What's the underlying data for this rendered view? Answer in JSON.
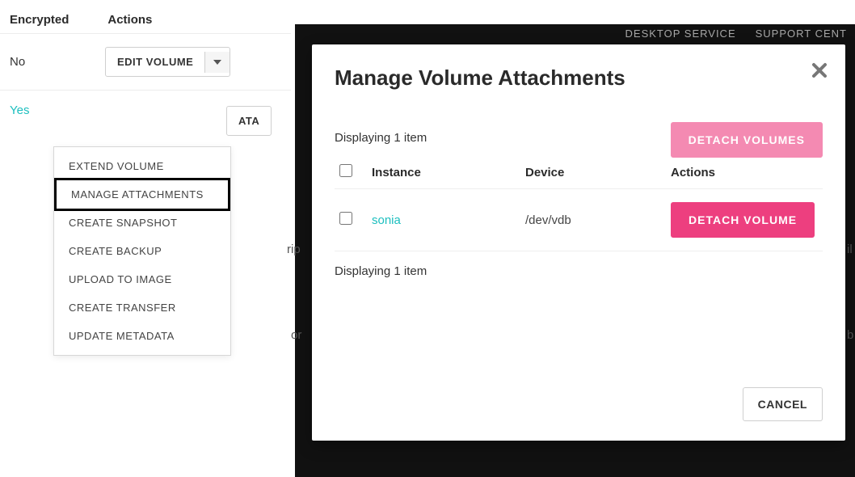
{
  "columns": {
    "encrypted": "Encrypted",
    "actions": "Actions"
  },
  "rows": [
    {
      "encrypted": "No",
      "action_label": "EDIT VOLUME"
    },
    {
      "encrypted": "Yes",
      "action_label_fragment": "ATA"
    }
  ],
  "dropdown": {
    "items": [
      "EXTEND VOLUME",
      "MANAGE ATTACHMENTS",
      "CREATE SNAPSHOT",
      "CREATE BACKUP",
      "UPLOAD TO IMAGE",
      "CREATE TRANSFER",
      "UPDATE METADATA"
    ]
  },
  "nav": {
    "desktop": "DESKTOP SERVICE",
    "support": "SUPPORT CENT"
  },
  "modal": {
    "title": "Manage Volume Attachments",
    "detach_all": "DETACH VOLUMES",
    "displaying_top": "Displaying 1 item",
    "displaying_bottom": "Displaying 1 item",
    "th_instance": "Instance",
    "th_device": "Device",
    "th_actions": "Actions",
    "row": {
      "instance": "sonia",
      "device": "/dev/vdb",
      "detach": "DETACH VOLUME"
    },
    "cancel": "CANCEL"
  },
  "bg_fragments": {
    "rip": "rip",
    "or": "or",
    "il": "il",
    "b": "b"
  }
}
